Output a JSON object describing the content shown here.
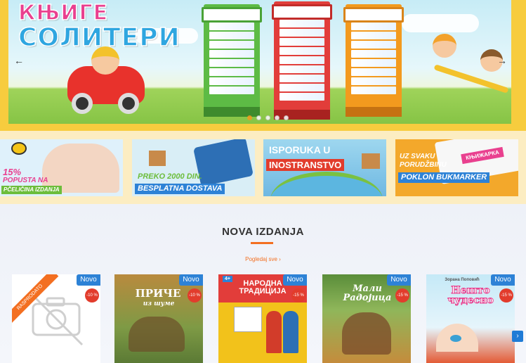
{
  "hero": {
    "title_line1": "КЊИГЕ",
    "title_line2": "СОЛИТЕРИ",
    "slides": 5,
    "active_slide": 1
  },
  "promos": [
    {
      "line1": "15%",
      "line2": "POPUSTA NA",
      "line3": "PČELIČINA IZDANJA"
    },
    {
      "line1": "PREKO 2000 DIN.",
      "line2": "BESPLATNA DOSTAVA"
    },
    {
      "line1": "ISPORUKA U",
      "line2": "INOSTRANSTVO"
    },
    {
      "line1": "UZ SVAKU",
      "line2": "PORUDŽBINU",
      "line3": "POKLON BUKMARKER",
      "brand": "КЊИЖАРКА"
    }
  ],
  "new_releases": {
    "title": "NOVA IZDANJA",
    "see_all": "Pogledaj sve ›",
    "next_icon": "›",
    "products": [
      {
        "badge": "Novo",
        "discount": "-10 %",
        "ribbon": "RASPRODATO",
        "cover_title": ""
      },
      {
        "badge": "Novo",
        "discount": "-10 %",
        "cover_title": "ПРИЧЕ",
        "cover_subtitle": "из шуме"
      },
      {
        "badge": "Novo",
        "discount": "-15 %",
        "cover_title": "НАРОДНА ТРАДИЦИЈА",
        "cover_tag": "4+"
      },
      {
        "badge": "Novo",
        "discount": "-15 %",
        "cover_title": "Мали Радојица"
      },
      {
        "badge": "Novo",
        "discount": "-15 %",
        "cover_title": "Нешто чудесно",
        "cover_author": "Зорана Поповић"
      }
    ]
  },
  "colors": {
    "accent": "#f36f21",
    "badge_blue": "#2d82d6",
    "discount_red": "#e23c2c",
    "hero_frame": "#f7cc3e"
  }
}
